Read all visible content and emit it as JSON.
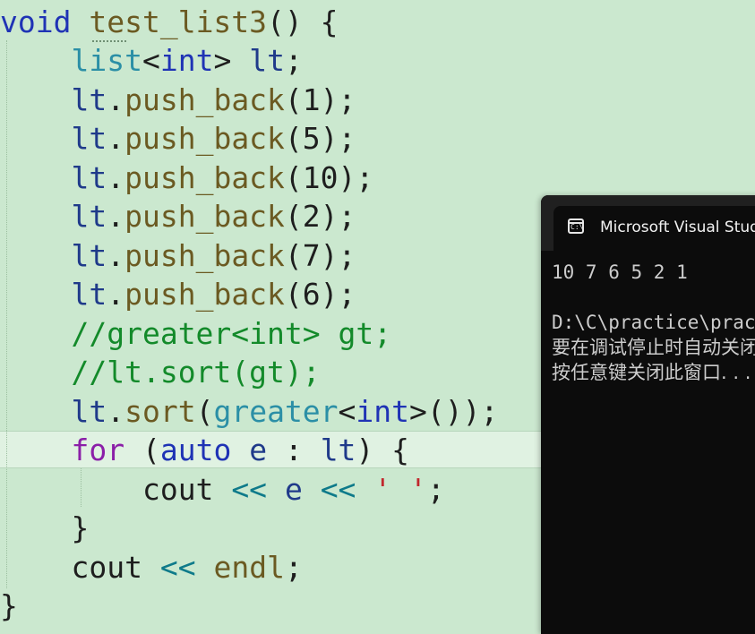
{
  "editor": {
    "lines": [
      [
        {
          "c": "kw",
          "t": "void"
        },
        {
          "c": "pl",
          "t": " "
        },
        {
          "c": "fn",
          "t": "test_list3"
        },
        {
          "c": "pl",
          "t": "() {"
        }
      ],
      [
        {
          "c": "pl",
          "t": "    "
        },
        {
          "c": "type",
          "t": "list"
        },
        {
          "c": "pl",
          "t": "<"
        },
        {
          "c": "kw",
          "t": "int"
        },
        {
          "c": "pl",
          "t": "> "
        },
        {
          "c": "var",
          "t": "lt"
        },
        {
          "c": "pl",
          "t": ";"
        }
      ],
      [
        {
          "c": "pl",
          "t": "    "
        },
        {
          "c": "var",
          "t": "lt"
        },
        {
          "c": "pl",
          "t": "."
        },
        {
          "c": "fn",
          "t": "push_back"
        },
        {
          "c": "pl",
          "t": "("
        },
        {
          "c": "num",
          "t": "1"
        },
        {
          "c": "pl",
          "t": ");"
        }
      ],
      [
        {
          "c": "pl",
          "t": "    "
        },
        {
          "c": "var",
          "t": "lt"
        },
        {
          "c": "pl",
          "t": "."
        },
        {
          "c": "fn",
          "t": "push_back"
        },
        {
          "c": "pl",
          "t": "("
        },
        {
          "c": "num",
          "t": "5"
        },
        {
          "c": "pl",
          "t": ");"
        }
      ],
      [
        {
          "c": "pl",
          "t": "    "
        },
        {
          "c": "var",
          "t": "lt"
        },
        {
          "c": "pl",
          "t": "."
        },
        {
          "c": "fn",
          "t": "push_back"
        },
        {
          "c": "pl",
          "t": "("
        },
        {
          "c": "num",
          "t": "10"
        },
        {
          "c": "pl",
          "t": ");"
        }
      ],
      [
        {
          "c": "pl",
          "t": "    "
        },
        {
          "c": "var",
          "t": "lt"
        },
        {
          "c": "pl",
          "t": "."
        },
        {
          "c": "fn",
          "t": "push_back"
        },
        {
          "c": "pl",
          "t": "("
        },
        {
          "c": "num",
          "t": "2"
        },
        {
          "c": "pl",
          "t": ");"
        }
      ],
      [
        {
          "c": "pl",
          "t": "    "
        },
        {
          "c": "var",
          "t": "lt"
        },
        {
          "c": "pl",
          "t": "."
        },
        {
          "c": "fn",
          "t": "push_back"
        },
        {
          "c": "pl",
          "t": "("
        },
        {
          "c": "num",
          "t": "7"
        },
        {
          "c": "pl",
          "t": ");"
        }
      ],
      [
        {
          "c": "pl",
          "t": "    "
        },
        {
          "c": "var",
          "t": "lt"
        },
        {
          "c": "pl",
          "t": "."
        },
        {
          "c": "fn",
          "t": "push_back"
        },
        {
          "c": "pl",
          "t": "("
        },
        {
          "c": "num",
          "t": "6"
        },
        {
          "c": "pl",
          "t": ");"
        }
      ],
      [
        {
          "c": "pl",
          "t": "    "
        },
        {
          "c": "cm",
          "t": "//greater<int> gt;"
        }
      ],
      [
        {
          "c": "pl",
          "t": "    "
        },
        {
          "c": "cm",
          "t": "//lt.sort(gt);"
        }
      ],
      [
        {
          "c": "pl",
          "t": "    "
        },
        {
          "c": "var",
          "t": "lt"
        },
        {
          "c": "pl",
          "t": "."
        },
        {
          "c": "fn",
          "t": "sort"
        },
        {
          "c": "pl",
          "t": "("
        },
        {
          "c": "type",
          "t": "greater"
        },
        {
          "c": "pl",
          "t": "<"
        },
        {
          "c": "kw",
          "t": "int"
        },
        {
          "c": "pl",
          "t": ">());"
        }
      ],
      [
        {
          "c": "pl",
          "t": "    "
        },
        {
          "c": "ctrl",
          "t": "for"
        },
        {
          "c": "pl",
          "t": " ("
        },
        {
          "c": "kw",
          "t": "auto"
        },
        {
          "c": "pl",
          "t": " "
        },
        {
          "c": "var",
          "t": "e"
        },
        {
          "c": "pl",
          "t": " : "
        },
        {
          "c": "var",
          "t": "lt"
        },
        {
          "c": "pl",
          "t": ") {"
        }
      ],
      [
        {
          "c": "pl",
          "t": "        "
        },
        {
          "c": "pl",
          "t": "cout"
        },
        {
          "c": "pl",
          "t": " "
        },
        {
          "c": "op",
          "t": "<<"
        },
        {
          "c": "pl",
          "t": " "
        },
        {
          "c": "var",
          "t": "e"
        },
        {
          "c": "pl",
          "t": " "
        },
        {
          "c": "op",
          "t": "<<"
        },
        {
          "c": "pl",
          "t": " "
        },
        {
          "c": "str",
          "t": "' '"
        },
        {
          "c": "pl",
          "t": ";"
        }
      ],
      [
        {
          "c": "pl",
          "t": "    "
        },
        {
          "c": "pl",
          "t": "}"
        }
      ],
      [
        {
          "c": "pl",
          "t": "    "
        },
        {
          "c": "pl",
          "t": "cout"
        },
        {
          "c": "pl",
          "t": " "
        },
        {
          "c": "op",
          "t": "<<"
        },
        {
          "c": "pl",
          "t": " "
        },
        {
          "c": "fn",
          "t": "endl"
        },
        {
          "c": "pl",
          "t": ";"
        }
      ],
      [
        {
          "c": "pl",
          "t": "}"
        }
      ]
    ]
  },
  "console": {
    "title": "Microsoft Visual Studio",
    "icon": "console-icon",
    "output_line": "10 7 6 5 2 1",
    "path_line": "D:\\C\\practice\\practice",
    "message_line1": "要在调试停止时自动关闭控制台",
    "message_line2": "按任意键关闭此窗口. . ."
  }
}
